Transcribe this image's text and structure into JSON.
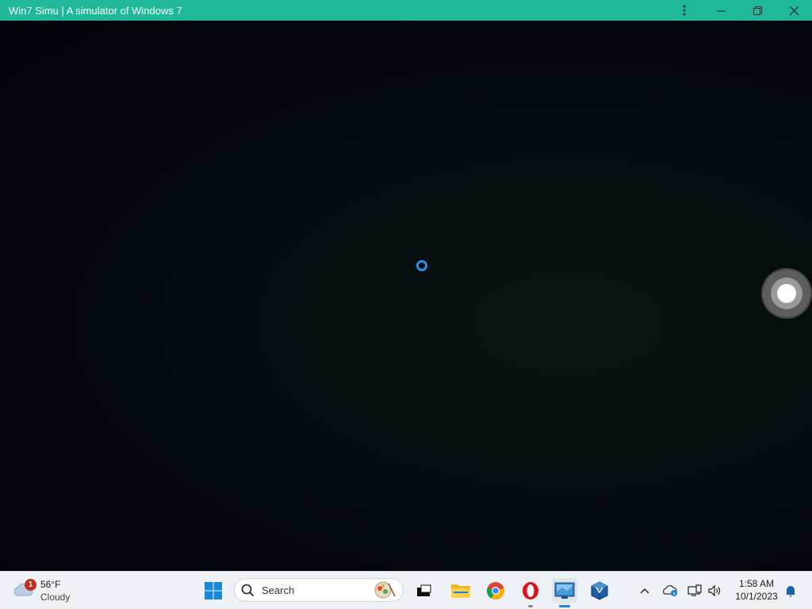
{
  "window": {
    "title": "Win7 Simu | A simulator of Windows 7",
    "icons": [
      "more-options-icon",
      "minimize-icon",
      "restore-icon",
      "close-icon"
    ]
  },
  "app": {
    "state": "loading",
    "icons": [
      "loading-spinner",
      "floating-assistive-button"
    ]
  },
  "taskbar": {
    "weather": {
      "badge": "1",
      "temperature": "56°F",
      "condition": "Cloudy",
      "icon": "cloud-icon"
    },
    "search": {
      "label": "Search",
      "icon": "search-icon"
    },
    "apps": [
      {
        "name": "start",
        "icon": "windows-logo-icon"
      },
      {
        "name": "task-view",
        "icon": "task-view-icon"
      },
      {
        "name": "file-explorer",
        "icon": "folder-icon"
      },
      {
        "name": "chrome",
        "icon": "chrome-icon"
      },
      {
        "name": "opera",
        "icon": "opera-icon"
      },
      {
        "name": "win7-simu",
        "icon": "win7-simu-icon",
        "active": true
      },
      {
        "name": "virtualbox",
        "icon": "virtualbox-icon"
      }
    ],
    "tray": [
      "chevron-up-icon",
      "onedrive-info-icon",
      "network-icon",
      "volume-icon"
    ],
    "clock": {
      "time": "1:58 AM",
      "date": "10/1/2023"
    },
    "notification_icon": "bell-icon"
  },
  "colors": {
    "titlebar": "#1fb99a",
    "accent": "#1e84d8",
    "badge": "#c42b1c"
  }
}
